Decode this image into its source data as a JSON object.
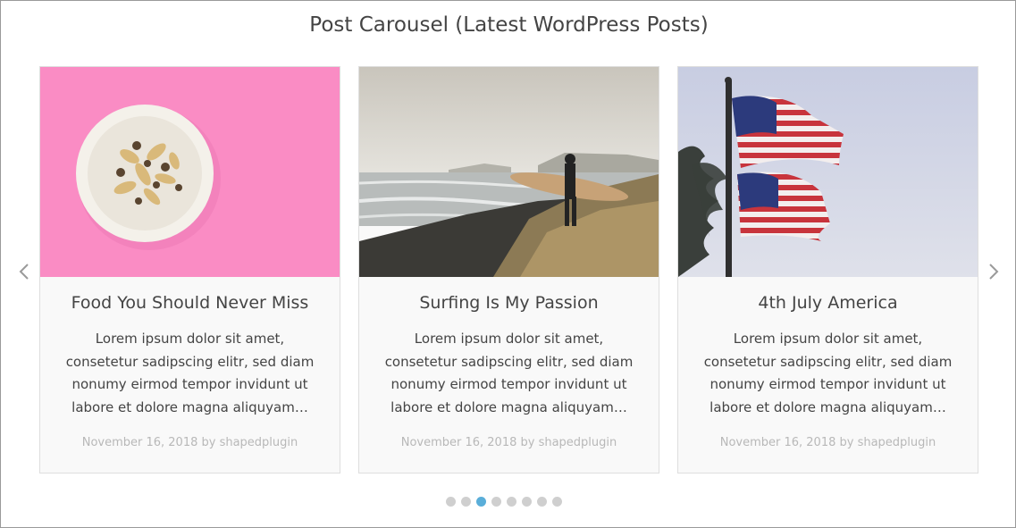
{
  "carousel": {
    "title": "Post Carousel (Latest WordPress Posts)",
    "prev_icon": "chevron-left-icon",
    "next_icon": "chevron-right-icon",
    "posts": [
      {
        "title": "Food You Should Never Miss",
        "excerpt": "Lorem ipsum dolor sit amet, consetetur sadipscing elitr, sed diam nonumy eirmod tempor invidunt ut labore et dolore magna aliquyam…",
        "meta": "November 16, 2018 by shapedplugin"
      },
      {
        "title": "Surfing Is My Passion",
        "excerpt": "Lorem ipsum dolor sit amet, consetetur sadipscing elitr, sed diam nonumy eirmod tempor invidunt ut labore et dolore magna aliquyam…",
        "meta": "November 16, 2018 by shapedplugin"
      },
      {
        "title": "4th July America",
        "excerpt": "Lorem ipsum dolor sit amet, consetetur sadipscing elitr, sed diam nonumy eirmod tempor invidunt ut labore et dolore magna aliquyam…",
        "meta": "November 16, 2018 by shapedplugin"
      }
    ],
    "pagination": {
      "total": 8,
      "active_index": 2
    },
    "colors": {
      "active_dot": "#5aaed9",
      "inactive_dot": "#cfcfcf",
      "meta_text": "#b8b8b8"
    }
  }
}
